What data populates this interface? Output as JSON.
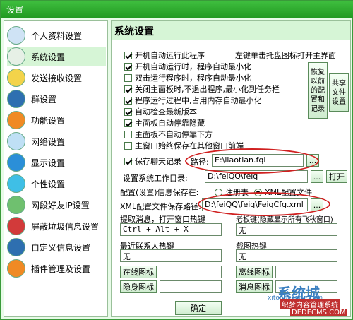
{
  "window": {
    "title": "设置"
  },
  "sidebar": {
    "items": [
      {
        "label": "个人资料设置",
        "icon": "person-icon",
        "color": "#cfe3f5"
      },
      {
        "label": "系统设置",
        "icon": "wheel-icon",
        "color": "#e6f0e6"
      },
      {
        "label": "发送接收设置",
        "icon": "folder-icon",
        "color": "#f3d34a"
      },
      {
        "label": "群设置",
        "icon": "group-icon",
        "color": "#2e6fb0"
      },
      {
        "label": "功能设置",
        "icon": "function-icon",
        "color": "#f08a24"
      },
      {
        "label": "网络设置",
        "icon": "network-icon",
        "color": "#bfe0f5"
      },
      {
        "label": "显示设置",
        "icon": "display-icon",
        "color": "#2b8fd8"
      },
      {
        "label": "个性设置",
        "icon": "star-icon",
        "color": "#3fbfe6"
      },
      {
        "label": "网段好友IP设置",
        "icon": "ip-icon",
        "color": "#6fc06f"
      },
      {
        "label": "屏蔽垃圾信息设置",
        "icon": "block-icon",
        "color": "#d23a3a"
      },
      {
        "label": "自定义信息设置",
        "icon": "custom-icon",
        "color": "#2e6fb0"
      },
      {
        "label": "插件管理及设置",
        "icon": "plugin-icon",
        "color": "#f08a24"
      }
    ]
  },
  "panel": {
    "title": "系统设置",
    "options": [
      {
        "label": "开机自动运行此程序",
        "checked": true
      },
      {
        "label": "左键单击托盘图标打开主界面",
        "checked": false
      },
      {
        "label": "开机自动运行时，程序自动最小化",
        "checked": true
      },
      {
        "label": "双击运行程序时，程序自动最小化",
        "checked": false
      },
      {
        "label": "关闭主面板时,不退出程序,最小化到任务栏",
        "checked": true
      },
      {
        "label": "程序运行过程中,占用内存自动最小化",
        "checked": true
      },
      {
        "label": "自动检查最新版本",
        "checked": true
      },
      {
        "label": "主面板自动停靠隐藏",
        "checked": true
      },
      {
        "label": "主面板不自动停靠下方",
        "checked": false
      },
      {
        "label": "主窗口始终保存在其他窗口前端",
        "checked": false
      },
      {
        "label": "保存聊天记录",
        "checked": true
      }
    ],
    "restore_button": "恢复以前的配置和记录",
    "share_button": "共享文件设置",
    "chat_path_label": "路径:",
    "chat_path_value": "E:\\liaotian.fql",
    "workdir_label": "设置系统工作目录:",
    "workdir_value": "D:\\feiQQ\\feiq",
    "browse": "...",
    "open_button": "打开",
    "config_save_label": "配置(设置)信息保存在:",
    "registry_label": "注册表",
    "xml_label": "XML配置文件",
    "xml_path_label": "XML配置文件保存路径:",
    "xml_path_value": "D:\\feiQQ\\feiq\\FeiqCfg.xml",
    "hotkey_extract_label": "提取消息，打开窗口热键",
    "hotkey_extract_value": "Ctrl + Alt + X",
    "hotkey_boss_label": "老板键(隐藏显示所有飞秋窗口)",
    "hotkey_boss_value": "无",
    "hotkey_recent_label": "最近联系人热键",
    "hotkey_recent_value": "无",
    "hotkey_screenshot_label": "截图热键",
    "hotkey_screenshot_value": "无",
    "online_icon": "在线图标",
    "offline_icon": "离线图标",
    "hidden_icon": "隐身图标",
    "message_icon": "消息图标",
    "ok_button": "确定"
  },
  "watermark": {
    "brand": "系统城",
    "site": "xitongcheng.com",
    "cn": "织梦内容管理系统",
    "url": "DEDECMS.COM"
  },
  "colors": {
    "accent": "#229a22",
    "annotation": "#d02020"
  }
}
